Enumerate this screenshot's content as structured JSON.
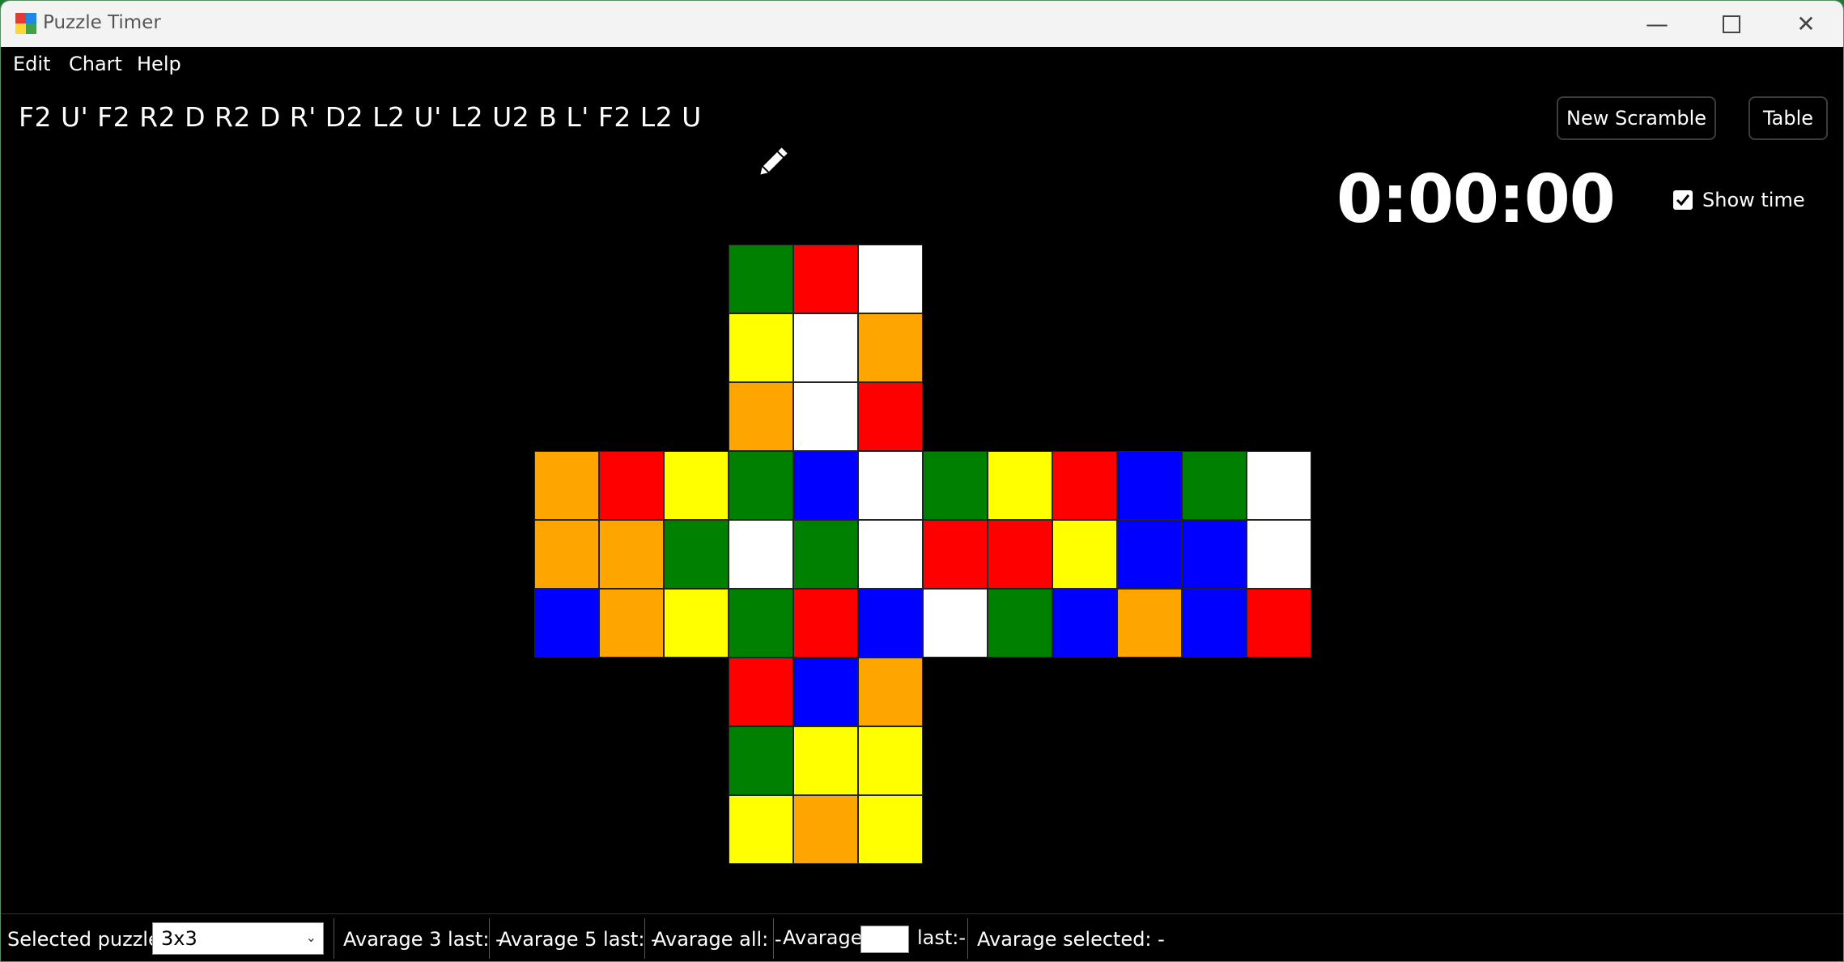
{
  "window": {
    "title": "Puzzle Timer"
  },
  "menu": {
    "items": [
      "Edit",
      "Chart",
      "Help"
    ]
  },
  "scramble": "F2 U' F2 R2 D R2 D R' D2 L2 U' L2 U2 B L' F2 L2 U",
  "buttons": {
    "new_scramble": "New Scramble",
    "table": "Table"
  },
  "timer": {
    "value": "0:00:00",
    "show_time_label": "Show time",
    "show_time_checked": true
  },
  "colors": {
    "W": "#ffffff",
    "Y": "#ffff00",
    "R": "#ff0000",
    "O": "#ffa500",
    "G": "#008000",
    "B": "#0000ff"
  },
  "cube": {
    "up": [
      [
        "G",
        "R",
        "W"
      ],
      [
        "Y",
        "W",
        "O"
      ],
      [
        "O",
        "W",
        "R"
      ]
    ],
    "left": [
      [
        "O",
        "R",
        "Y"
      ],
      [
        "O",
        "O",
        "G"
      ],
      [
        "B",
        "O",
        "Y"
      ]
    ],
    "front": [
      [
        "G",
        "B",
        "W"
      ],
      [
        "W",
        "G",
        "W"
      ],
      [
        "G",
        "R",
        "B"
      ]
    ],
    "right": [
      [
        "G",
        "Y",
        "R"
      ],
      [
        "R",
        "R",
        "Y"
      ],
      [
        "W",
        "G",
        "B"
      ]
    ],
    "back": [
      [
        "B",
        "G",
        "W"
      ],
      [
        "B",
        "B",
        "W"
      ],
      [
        "O",
        "B",
        "R"
      ]
    ],
    "down": [
      [
        "R",
        "B",
        "O"
      ],
      [
        "G",
        "Y",
        "Y"
      ],
      [
        "Y",
        "O",
        "Y"
      ]
    ]
  },
  "status": {
    "selected_puzzle_label": "Selected puzzle:",
    "selected_puzzle_value": "3x3",
    "avg3": "Avarage 3 last: -",
    "avg5": "Avarage 5 last: -",
    "avg_all": "Avarage all: -",
    "avg_label": "Avarage",
    "last_label": "last:-",
    "avg_selected": "Avarage  selected: -"
  }
}
